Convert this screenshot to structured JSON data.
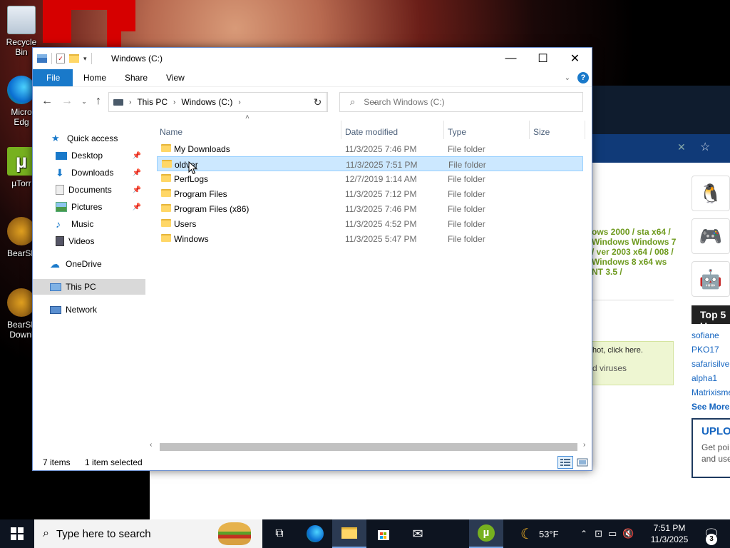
{
  "desktop": {
    "icons": [
      {
        "label": "Recycle Bin"
      },
      {
        "label": "Micro Edg"
      },
      {
        "label": "µTorr"
      },
      {
        "label": "BearSh"
      },
      {
        "label": "BearSh Downl"
      }
    ]
  },
  "background_site": {
    "green_text": "ows 2000 / sta x64 / Windows Windows 7 / ver 2003 x64 / 008 / Windows 8 x64 ws NT 3.5 /",
    "top5_title": "Top 5 U",
    "top_users": [
      "sofiane",
      "PKO17",
      "safarisilve",
      "alpha1",
      "Matrixisme"
    ],
    "see_more": "See More",
    "note_line1": "hot, click here.",
    "note_line2": "d viruses",
    "upload_title": "UPLO",
    "upload_desc": "Get poi and use"
  },
  "explorer": {
    "title": "Windows (C:)",
    "ribbon_tabs": {
      "file": "File",
      "home": "Home",
      "share": "Share",
      "view": "View"
    },
    "help": "?",
    "breadcrumb": [
      "This PC",
      "Windows (C:)"
    ],
    "search_placeholder": "Search Windows (C:)",
    "columns": {
      "name": "Name",
      "date": "Date modified",
      "type": "Type",
      "size": "Size"
    },
    "nav_pane": {
      "quick_access": "Quick access",
      "desktop": "Desktop",
      "downloads": "Downloads",
      "documents": "Documents",
      "pictures": "Pictures",
      "music": "Music",
      "videos": "Videos",
      "onedrive": "OneDrive",
      "this_pc": "This PC",
      "network": "Network"
    },
    "files": [
      {
        "name": "My Downloads",
        "date": "11/3/2025 7:46 PM",
        "type": "File folder"
      },
      {
        "name": "oldver",
        "date": "11/3/2025 7:51 PM",
        "type": "File folder",
        "selected": true
      },
      {
        "name": "PerfLogs",
        "date": "12/7/2019 1:14 AM",
        "type": "File folder"
      },
      {
        "name": "Program Files",
        "date": "11/3/2025 7:12 PM",
        "type": "File folder"
      },
      {
        "name": "Program Files (x86)",
        "date": "11/3/2025 7:46 PM",
        "type": "File folder"
      },
      {
        "name": "Users",
        "date": "11/3/2025 4:52 PM",
        "type": "File folder"
      },
      {
        "name": "Windows",
        "date": "11/3/2025 5:47 PM",
        "type": "File folder"
      }
    ],
    "status": {
      "items": "7 items",
      "selected": "1 item selected"
    }
  },
  "taskbar": {
    "search_placeholder": "Type here to search",
    "weather": "53°F",
    "time": "7:51 PM",
    "date": "11/3/2025",
    "notification_count": "3"
  },
  "colors": {
    "accent": "#1979ca",
    "selection": "#cce8ff",
    "taskbar": "#0d1420",
    "green_link": "#6e9a1e"
  }
}
